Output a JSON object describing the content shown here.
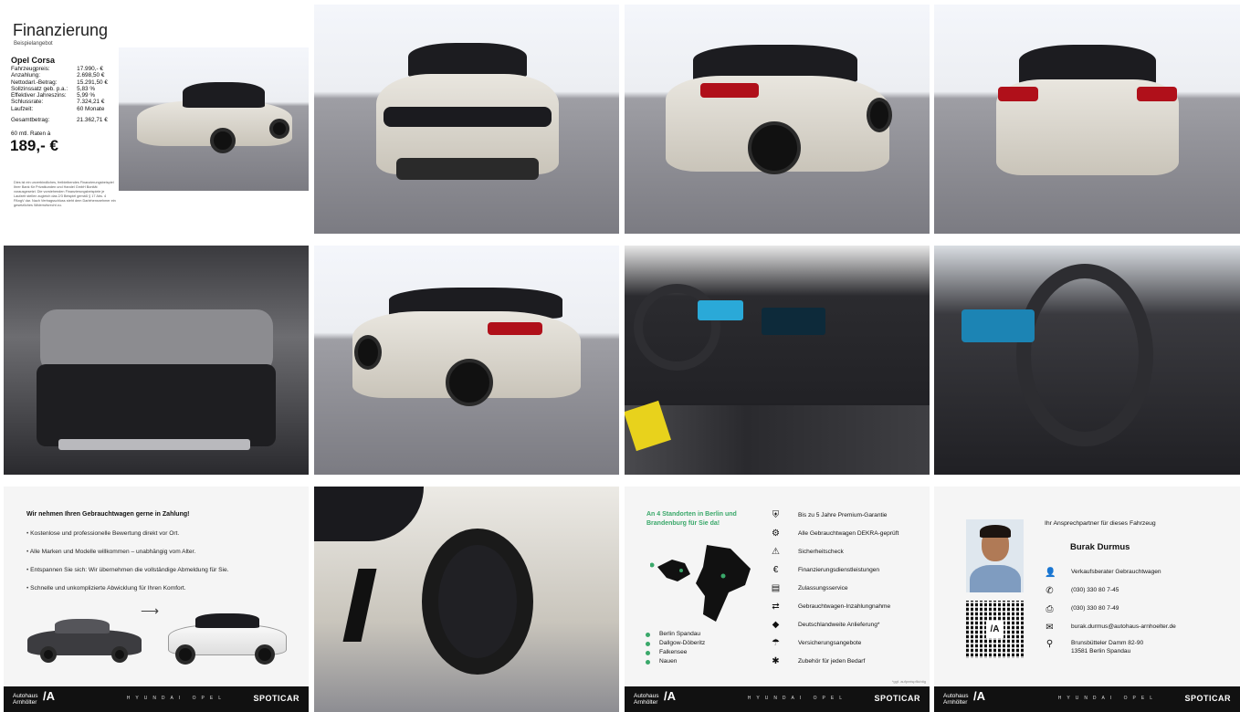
{
  "financing": {
    "title": "Finanzierung",
    "subtitle": "Beispielangebot",
    "model": "Opel Corsa",
    "rows": [
      {
        "label": "Fahrzeugpreis:",
        "value": "17.990,- €"
      },
      {
        "label": "Anzahlung:",
        "value": "2.698,50 €"
      },
      {
        "label": "Nettodarl.-Betrag:",
        "value": "15.291,50 €"
      },
      {
        "label": "Sollzinssatz geb. p.a.:",
        "value": "5,83 %"
      },
      {
        "label": "Effektiver Jahreszins:",
        "value": "5,99 %"
      },
      {
        "label": "Schlussrate:",
        "value": "7.324,21 €"
      },
      {
        "label": "Laufzeit:",
        "value": "60 Monate"
      }
    ],
    "total_label": "Gesamtbetrag:",
    "total_value": "21.362,71 €",
    "rate_label": "60 mtl. Raten à",
    "rate_value": "189,- €",
    "fineprint": "Dies ist ein unverbindliches, freibleibendes Finanzierungsbeispiel Ihrer Bank für Privatkunden und Handel GmbH Bonität vorausgesetzt. Die vorstehenden Finanzierungsbeispiele je Laufzeit stellen zugleich das 2/3 Beispiel gemäß § 17 Abs. 4 PAngV dar. Nach Vertragsschluss steht dem Darlehensnehmer ein gesetzliches Widerrufsrecht zu."
  },
  "tradein": {
    "title": "Wir nehmen Ihren Gebrauchtwagen gerne in Zahlung!",
    "bullets": [
      "Kostenlose und professionelle Bewertung direkt vor Ort.",
      "Alle Marken und Modelle willkommen – unabhängig vom Alter.",
      "Entspannen Sie sich: Wir übernehmen die vollständige Abmeldung für Sie.",
      "Schnelle und unkomplizierte Abwicklung für Ihren Komfort."
    ]
  },
  "locations": {
    "title": "An 4 Standorten in Berlin und Brandenburg für Sie da!",
    "places": [
      "Berlin Spandau",
      "Dallgow-Döberitz",
      "Falkensee",
      "Nauen"
    ],
    "services": [
      {
        "icon": "shield-icon",
        "label": "Bis zu 5 Jahre Premium-Garantie"
      },
      {
        "icon": "car-check-icon",
        "label": "Alle Gebrauchtwagen DEKRA-geprüft"
      },
      {
        "icon": "warning-icon",
        "label": "Sicherheitscheck"
      },
      {
        "icon": "money-icon",
        "label": "Finanzierungsdienstleistungen"
      },
      {
        "icon": "registration-icon",
        "label": "Zulassungsservice"
      },
      {
        "icon": "tradein-icon",
        "label": "Gebrauchtwagen-Inzahlungnahme"
      },
      {
        "icon": "germany-icon",
        "label": "Deutschlandweite Anlieferung*"
      },
      {
        "icon": "insurance-icon",
        "label": "Versicherungsangebote"
      },
      {
        "icon": "accessories-icon",
        "label": "Zubehör für jeden Bedarf"
      }
    ],
    "note": "*ggf. aufpreispflichtig"
  },
  "contact": {
    "heading": "Ihr Ansprechpartner für dieses Fahrzeug",
    "name": "Burak Durmus",
    "role": "Verkaufsberater Gebrauchtwagen",
    "phone": "(030) 330 80 7-45",
    "fax": "(030) 330 80 7-49",
    "email": "burak.durmus@autohaus-arnhoelter.de",
    "address_line1": "Brunsbütteler Damm 82-90",
    "address_line2": "13581 Berlin Spandau"
  },
  "footer": {
    "logo_line1": "Autohaus",
    "logo_line2": "Arnhölter",
    "logo_mark": "/A",
    "brands": "HYUNDAI OPEL",
    "spoticar": "SPOTICAR"
  }
}
